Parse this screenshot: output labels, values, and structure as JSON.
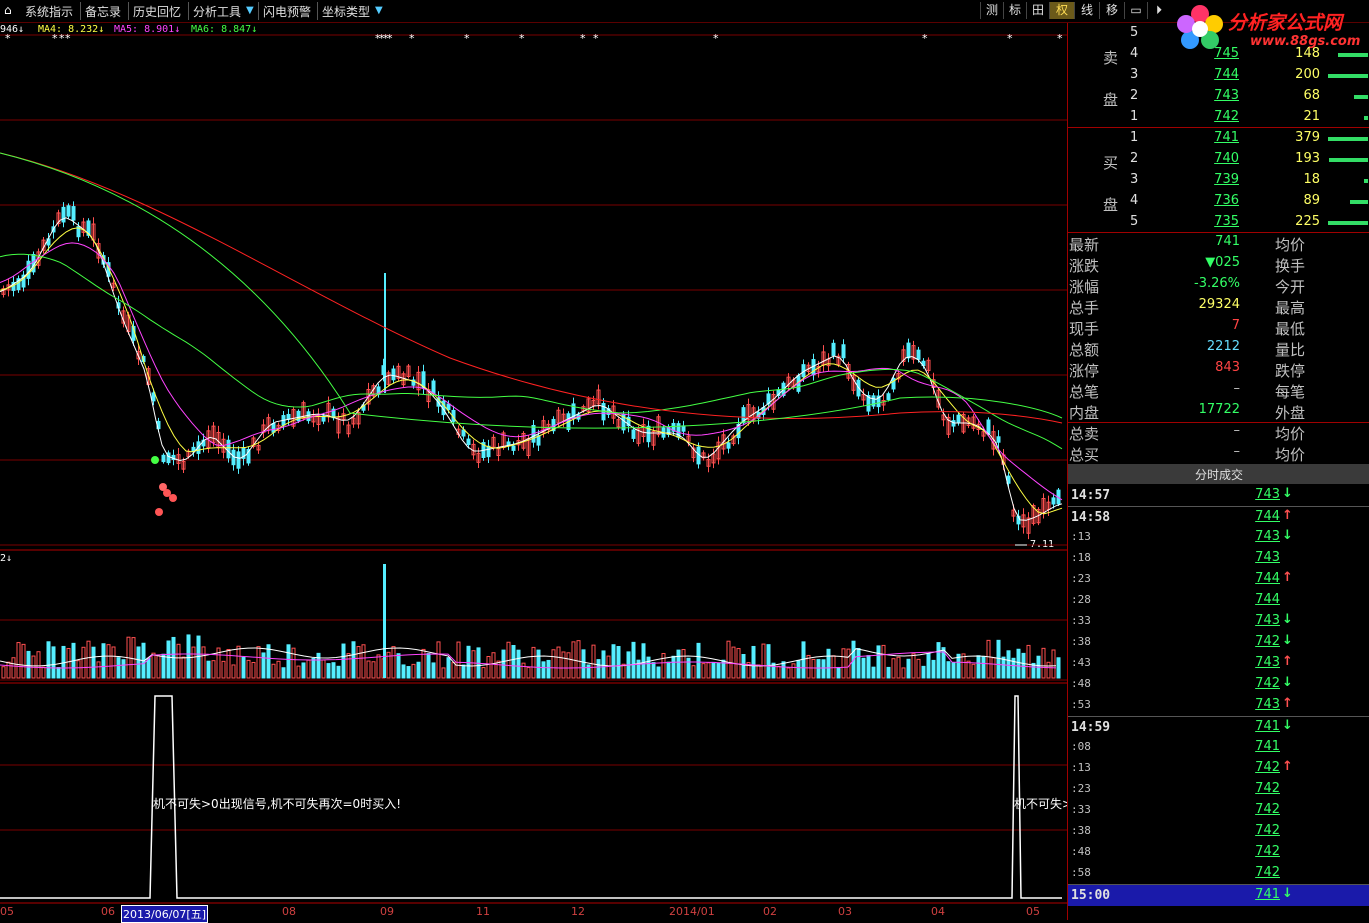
{
  "menu": {
    "items": [
      "系统指示",
      "备忘录",
      "历史回忆",
      "分析工具",
      "闪电预警",
      "坐标类型"
    ],
    "dropdown_marker": "▼"
  },
  "toolbar": {
    "buttons": [
      "测",
      "标",
      "田",
      "权",
      "线",
      "移",
      "▭",
      "⏵",
      "▫"
    ]
  },
  "logo": {
    "text": "分析家公式网",
    "url": "www.88gs.com"
  },
  "ma_legend": {
    "ma3": "946↓",
    "ma4": "MA4: 8.232↓",
    "ma5": "MA5: 8.901↓",
    "ma6": "MA6: 8.847↓"
  },
  "volume_label": "2↓",
  "low_marker": "7.11",
  "signal_text": "机不可失>0出现信号,机不可失再次=0时买入!",
  "signal_text_right": "机不可失>",
  "date_axis": {
    "labels": [
      "05",
      "06",
      "2013/06/07[五]",
      "08",
      "09",
      "11",
      "12",
      "2014/01",
      "02",
      "03",
      "04",
      "05"
    ]
  },
  "order_book": {
    "sell_label": [
      "卖",
      "盘"
    ],
    "buy_label": [
      "买",
      "盘"
    ],
    "sell": [
      {
        "level": "5",
        "price": "",
        "volume": ""
      },
      {
        "level": "4",
        "price": "745",
        "volume": "148"
      },
      {
        "level": "3",
        "price": "744",
        "volume": "200"
      },
      {
        "level": "2",
        "price": "743",
        "volume": "68"
      },
      {
        "level": "1",
        "price": "742",
        "volume": "21"
      }
    ],
    "buy": [
      {
        "level": "1",
        "price": "741",
        "volume": "379"
      },
      {
        "level": "2",
        "price": "740",
        "volume": "193"
      },
      {
        "level": "3",
        "price": "739",
        "volume": "18"
      },
      {
        "level": "4",
        "price": "736",
        "volume": "89"
      },
      {
        "level": "5",
        "price": "735",
        "volume": "225"
      }
    ]
  },
  "quote": [
    {
      "label": "最新",
      "value": "741",
      "color": "#33ff66",
      "right": "均价"
    },
    {
      "label": "涨跌",
      "value": "▼025",
      "color": "#33ff66",
      "right": "换手"
    },
    {
      "label": "涨幅",
      "value": "-3.26%",
      "color": "#33ff66",
      "right": "今开"
    },
    {
      "label": "总手",
      "value": "29324",
      "color": "#ffff66",
      "right": "最高"
    },
    {
      "label": "现手",
      "value": "7",
      "color": "#ff4444",
      "right": "最低"
    },
    {
      "label": "总额",
      "value": "2212",
      "color": "#66ddff",
      "right": "量比"
    },
    {
      "label": "涨停",
      "value": "843",
      "color": "#ff4444",
      "right": "跌停"
    },
    {
      "label": "总笔",
      "value": "–",
      "color": "#c0c0c0",
      "right": "每笔"
    },
    {
      "label": "内盘",
      "value": "17722",
      "color": "#33ff66",
      "right": "外盘"
    },
    {
      "label": "总卖",
      "value": "–",
      "color": "#c0c0c0",
      "right": "均价"
    },
    {
      "label": "总买",
      "value": "–",
      "color": "#c0c0c0",
      "right": "均价"
    }
  ],
  "ticks_header": "分时成交",
  "ticks": [
    {
      "time": "14:57",
      "price": "743",
      "dir": "down",
      "big": true
    },
    {
      "time": "14:58",
      "price": "744",
      "dir": "up",
      "big": true
    },
    {
      "time": ":13",
      "price": "743",
      "dir": "down"
    },
    {
      "time": ":18",
      "price": "743",
      "dir": ""
    },
    {
      "time": ":23",
      "price": "744",
      "dir": "up"
    },
    {
      "time": ":28",
      "price": "744",
      "dir": ""
    },
    {
      "time": ":33",
      "price": "743",
      "dir": "down"
    },
    {
      "time": ":38",
      "price": "742",
      "dir": "down"
    },
    {
      "time": ":43",
      "price": "743",
      "dir": "up"
    },
    {
      "time": ":48",
      "price": "742",
      "dir": "down"
    },
    {
      "time": ":53",
      "price": "743",
      "dir": "up"
    },
    {
      "time": "14:59",
      "price": "741",
      "dir": "down",
      "big": true
    },
    {
      "time": ":08",
      "price": "741",
      "dir": ""
    },
    {
      "time": ":13",
      "price": "742",
      "dir": "up"
    },
    {
      "time": ":23",
      "price": "742",
      "dir": ""
    },
    {
      "time": ":33",
      "price": "742",
      "dir": ""
    },
    {
      "time": ":38",
      "price": "742",
      "dir": ""
    },
    {
      "time": ":48",
      "price": "742",
      "dir": ""
    },
    {
      "time": ":58",
      "price": "742",
      "dir": ""
    },
    {
      "time": "15:00",
      "price": "741",
      "dir": "down",
      "big": true,
      "highlight": true
    }
  ],
  "colors": {
    "up": "#ff5050",
    "down": "#55eeff",
    "ma_white": "#ffffff",
    "ma_yellow": "#ffff44",
    "ma_magenta": "#ff44ff",
    "ma_green": "#44ff44",
    "ma_red": "#ff2222",
    "grid": "#7a0000"
  }
}
